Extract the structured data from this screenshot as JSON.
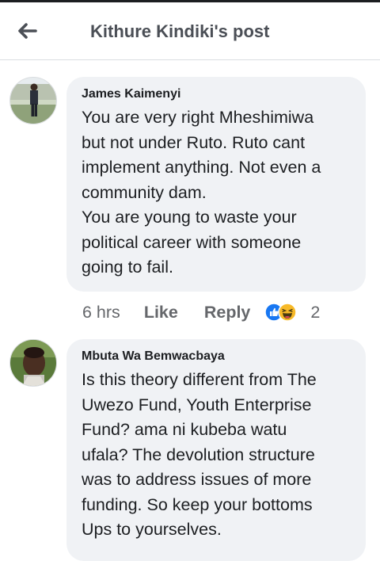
{
  "header": {
    "title": "Kithure Kindiki's post",
    "back_icon": "back-arrow-icon"
  },
  "colors": {
    "bubble": "#f0f2f5",
    "text": "#1c1e21",
    "meta": "#65676b",
    "like_blue": "#1877f2",
    "haha_yellow": "#f7b928"
  },
  "comments": [
    {
      "author": "James Kaimenyi",
      "lines": [
        "You are very right Mheshimiwa",
        "but not under Ruto. Ruto cant",
        "implement anything. Not even a",
        "community dam.",
        "You are young to waste your",
        "political career with someone",
        "going to fail."
      ],
      "time": "6 hrs",
      "like_label": "Like",
      "reply_label": "Reply",
      "reaction_icons": [
        "like-reaction-icon",
        "haha-reaction-icon"
      ],
      "reaction_count": "2"
    },
    {
      "author": "Mbuta Wa Bemwacbaya",
      "lines": [
        "Is this theory different from The",
        "Uwezo Fund, Youth Enterprise",
        "Fund? ama ni kubeba watu",
        "ufala? The devolution structure",
        "was to address issues of more",
        "funding. So keep your bottoms",
        "Ups to yourselves."
      ]
    }
  ]
}
